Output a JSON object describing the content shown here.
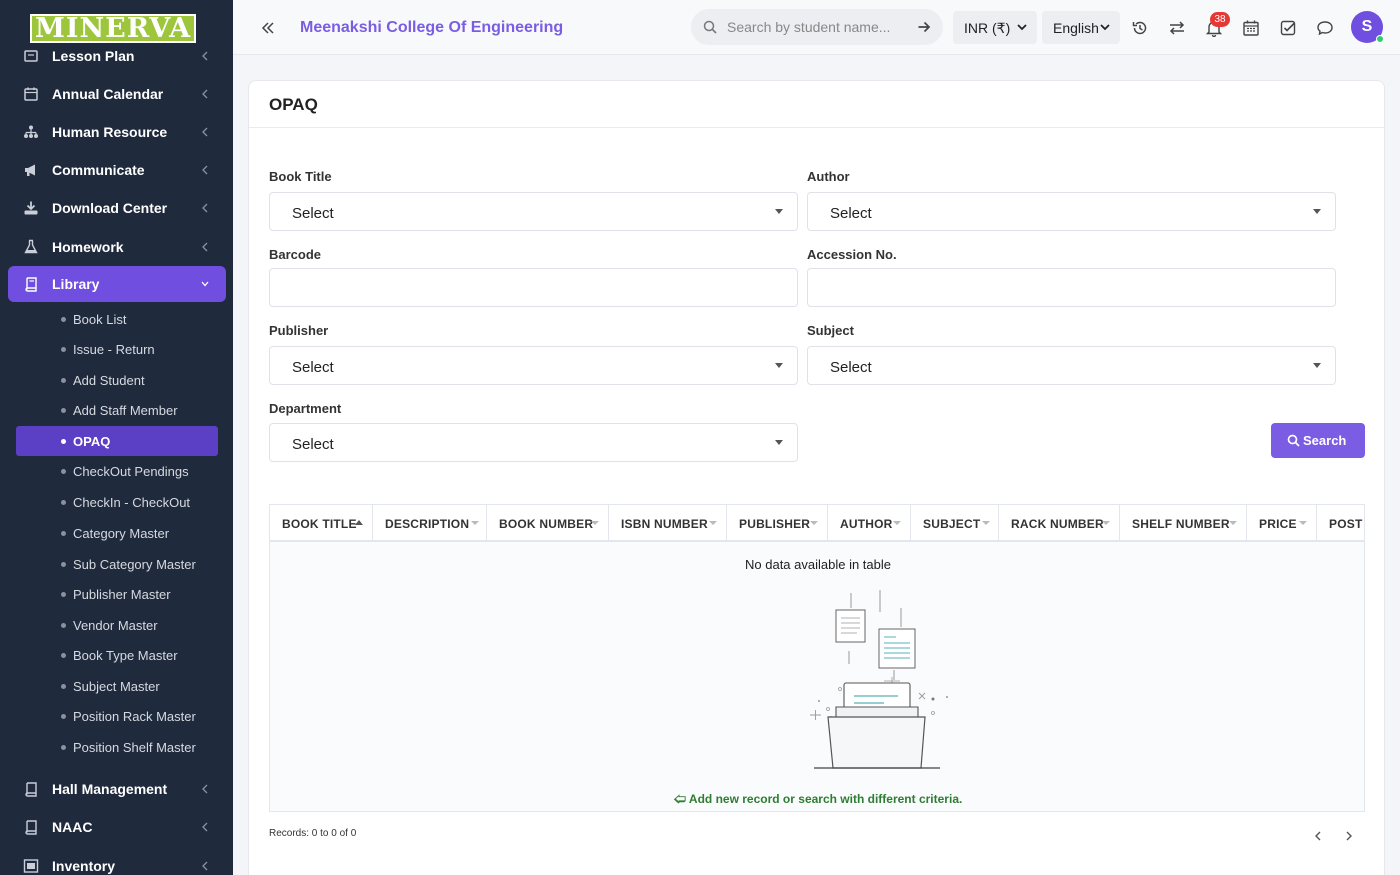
{
  "logo": "MINERVA",
  "sidebar": {
    "menu": [
      {
        "label": "Lesson Plan"
      },
      {
        "label": "Annual Calendar"
      },
      {
        "label": "Human Resource"
      },
      {
        "label": "Communicate"
      },
      {
        "label": "Download Center"
      },
      {
        "label": "Homework"
      },
      {
        "label": "Library"
      }
    ],
    "library_items": [
      {
        "label": "Book List"
      },
      {
        "label": "Issue - Return"
      },
      {
        "label": "Add Student"
      },
      {
        "label": "Add Staff Member"
      },
      {
        "label": "OPAQ"
      },
      {
        "label": "CheckOut Pendings"
      },
      {
        "label": "CheckIn - CheckOut"
      },
      {
        "label": "Category Master"
      },
      {
        "label": "Sub Category Master"
      },
      {
        "label": "Publisher Master"
      },
      {
        "label": "Vendor Master"
      },
      {
        "label": "Book Type Master"
      },
      {
        "label": "Subject Master"
      },
      {
        "label": "Position Rack Master"
      },
      {
        "label": "Position Shelf Master"
      }
    ],
    "menu_bottom": [
      {
        "label": "Hall Management"
      },
      {
        "label": "NAAC"
      },
      {
        "label": "Inventory"
      }
    ]
  },
  "topbar": {
    "college": "Meenakshi College Of Engineering",
    "search_placeholder": "Search by student name...",
    "currency": "INR (₹)",
    "language": "English",
    "notifications": "38",
    "avatar": "S"
  },
  "page": {
    "title": "OPAQ",
    "filters": {
      "book_title": {
        "label": "Book Title",
        "value": "Select"
      },
      "author": {
        "label": "Author",
        "value": "Select"
      },
      "barcode": {
        "label": "Barcode",
        "value": ""
      },
      "accession": {
        "label": "Accession No.",
        "value": ""
      },
      "publisher": {
        "label": "Publisher",
        "value": "Select"
      },
      "subject": {
        "label": "Subject",
        "value": "Select"
      },
      "department": {
        "label": "Department",
        "value": "Select"
      }
    },
    "search_button": "Search"
  },
  "table": {
    "columns": [
      "BOOK TITLE",
      "DESCRIPTION",
      "BOOK NUMBER",
      "ISBN NUMBER",
      "PUBLISHER",
      "AUTHOR",
      "SUBJECT",
      "RACK NUMBER",
      "SHELF NUMBER",
      "PRICE",
      "POST I"
    ],
    "empty_text": "No data available in table",
    "empty_hint": "Add new record or search with different criteria.",
    "records": "Records: 0 to 0 of 0"
  },
  "colors": {
    "sidebar_bg": "#1f2a3c",
    "accent": "#7b5de3",
    "logo_green": "#9dc63c",
    "hint_green": "#2e7d32",
    "badge_red": "#e53935"
  }
}
